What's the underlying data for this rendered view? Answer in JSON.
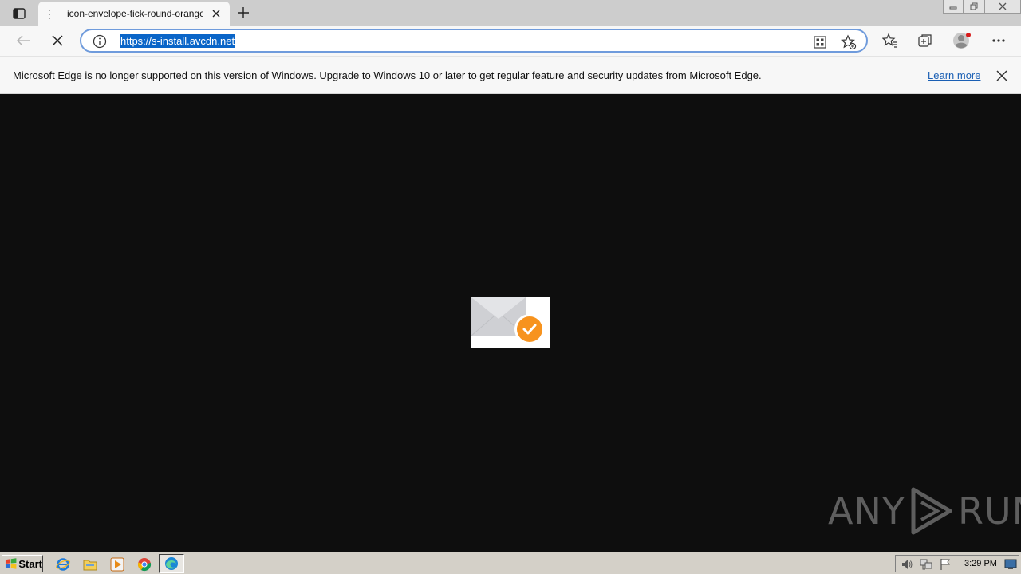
{
  "browser": {
    "tab_title": "icon-envelope-tick-round-orange",
    "tab_menu_glyph": "⋮",
    "url": "https://s-install.avcdn.net"
  },
  "infobar": {
    "message": "Microsoft Edge is no longer supported on this version of Windows. Upgrade to Windows 10 or later to get regular feature and security updates from Microsoft Edge.",
    "learn_more": "Learn more"
  },
  "content": {
    "image_name": "icon-envelope-tick-round-orange",
    "accent_color": "#f7931e"
  },
  "watermark": {
    "left": "ANY",
    "right": "RUN"
  },
  "taskbar": {
    "start_label": "Start",
    "clock": "3:29 PM",
    "quick_launch": [
      "ie-icon",
      "folder-icon",
      "media-player-icon",
      "chrome-icon",
      "edge-icon"
    ]
  }
}
